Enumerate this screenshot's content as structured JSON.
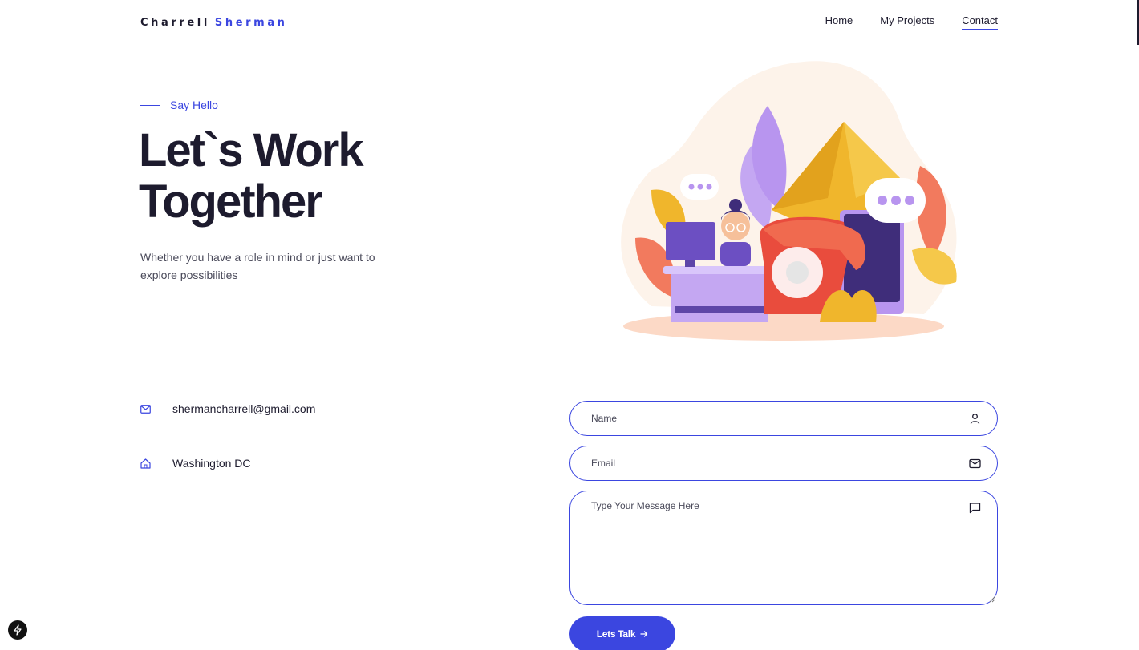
{
  "brand": {
    "first": "Charrell",
    "last": "Sherman"
  },
  "nav": {
    "items": [
      {
        "label": "Home"
      },
      {
        "label": "My Projects"
      },
      {
        "label": "Contact"
      }
    ],
    "active": "Contact"
  },
  "hero": {
    "eyebrow": "Say Hello",
    "headline_line1": "Let`s Work",
    "headline_line2": "Together",
    "subtext": "Whether you have a role in mind or just want to explore possibilities"
  },
  "contact": {
    "email": "shermancharrell@gmail.com",
    "location": "Washington DC"
  },
  "form": {
    "name_placeholder": "Name",
    "email_placeholder": "Email",
    "message_placeholder": "Type Your Message Here",
    "submit_label": "Lets Talk"
  },
  "colors": {
    "accent": "#3b46e0",
    "text": "#1d1b2e",
    "muted": "#4a4a5a"
  },
  "icons": {
    "email": "mail-icon",
    "location": "home-icon",
    "name_field": "user-icon",
    "email_field": "mail-icon",
    "message_field": "message-icon",
    "submit": "arrow-right-icon",
    "dev_badge": "lightning-icon"
  }
}
